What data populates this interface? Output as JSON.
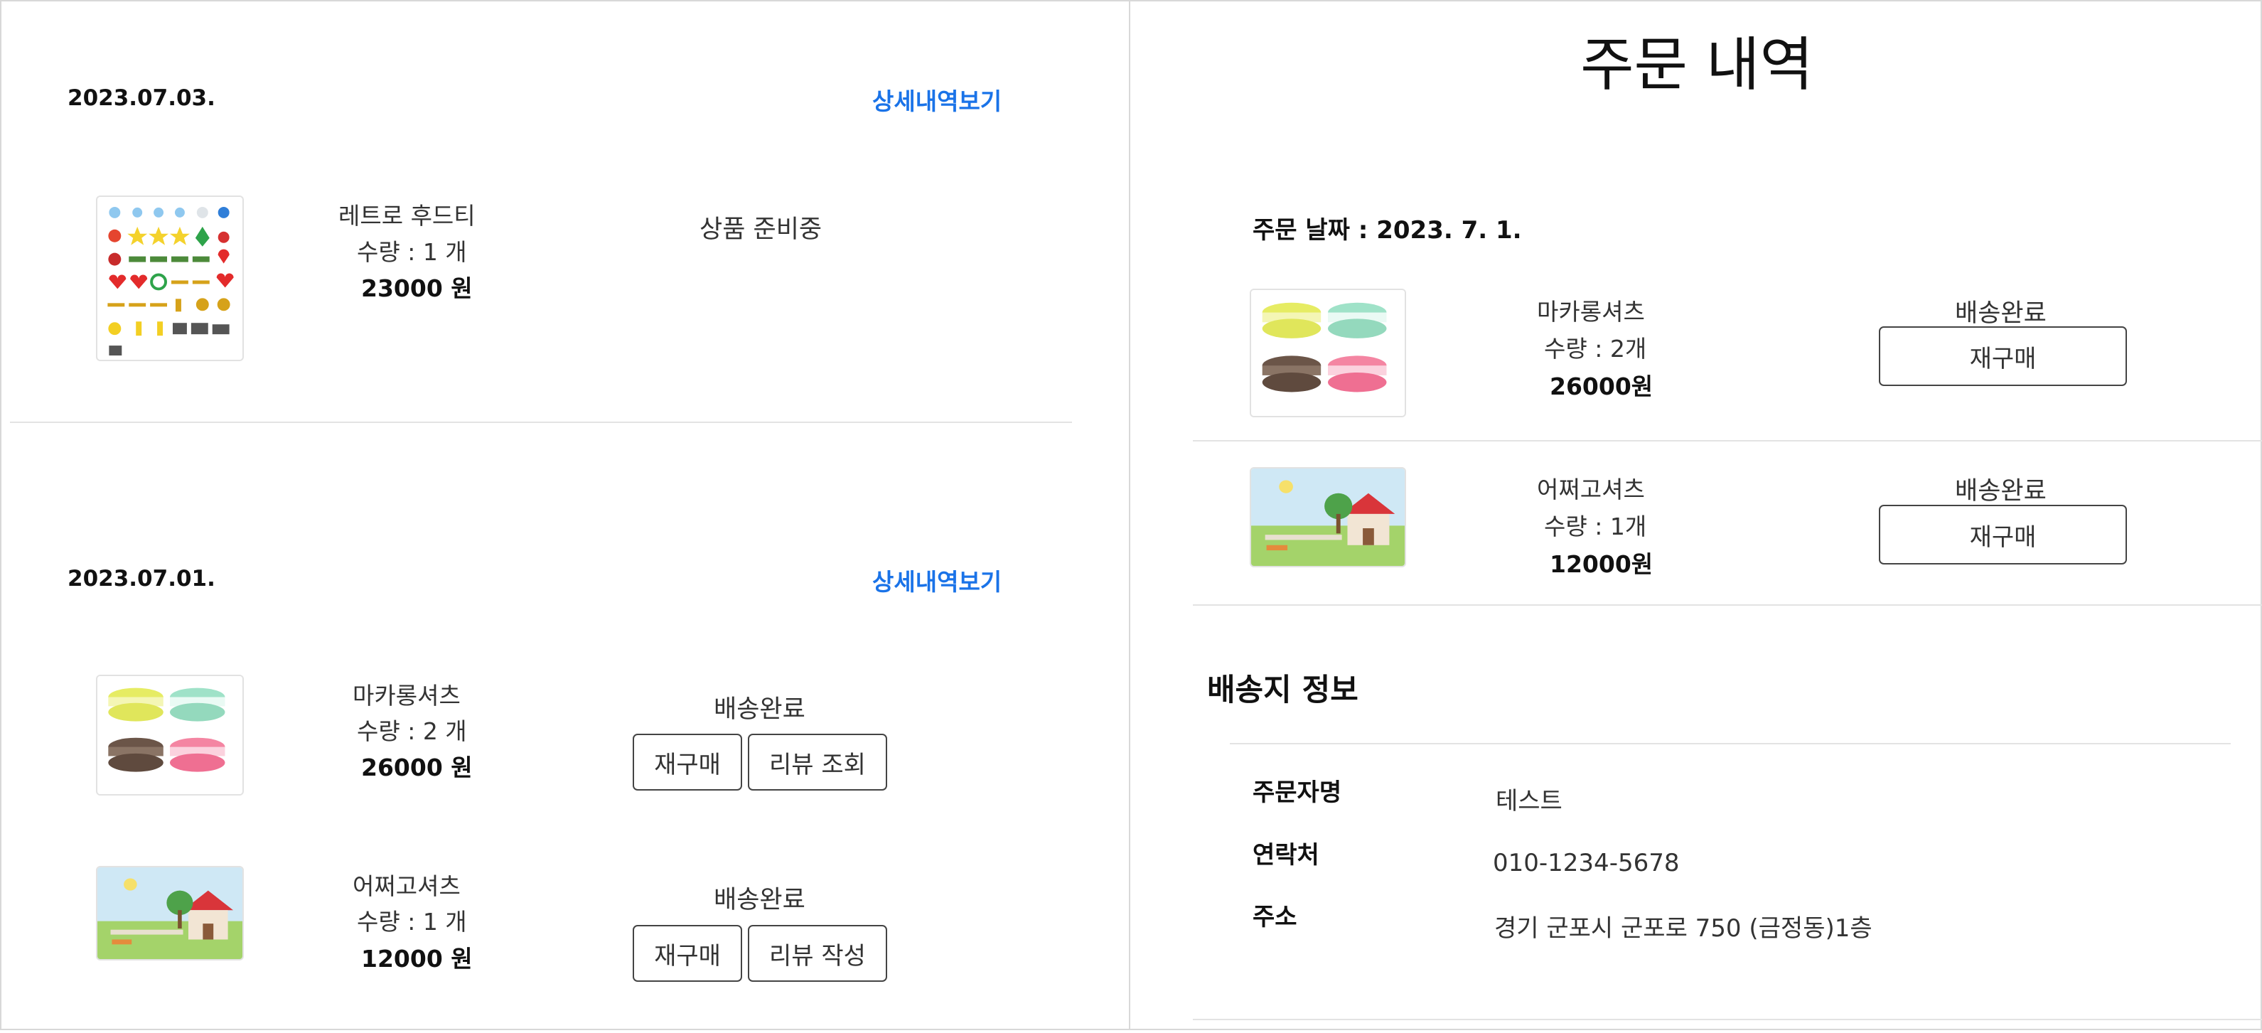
{
  "left": {
    "orders": [
      {
        "date": "2023.07.03.",
        "detail_link": "상세내역보기",
        "items": [
          {
            "name": "레트로 후드티",
            "qty": "수량 : 1 개",
            "price": "23000 원",
            "status": "상품 준비중",
            "buttons": []
          }
        ]
      },
      {
        "date": "2023.07.01.",
        "detail_link": "상세내역보기",
        "items": [
          {
            "name": "마카롱셔츠",
            "qty": "수량 : 2 개",
            "price": "26000 원",
            "status": "배송완료",
            "buttons": [
              "재구매",
              "리뷰 조회"
            ]
          },
          {
            "name": "어쩌고셔츠",
            "qty": "수량 : 1 개",
            "price": "12000 원",
            "status": "배송완료",
            "buttons": [
              "재구매",
              "리뷰 작성"
            ]
          }
        ]
      }
    ]
  },
  "right": {
    "title": "주문 내역",
    "order_date": "주문 날짜 : 2023. 7. 1.",
    "items": [
      {
        "name": "마카롱셔츠",
        "qty": "수량 : 2개",
        "price": "26000원",
        "status": "배송완료",
        "button": "재구매"
      },
      {
        "name": "어쩌고셔츠",
        "qty": "수량 : 1개",
        "price": "12000원",
        "status": "배송완료",
        "button": "재구매"
      }
    ],
    "shipping": {
      "heading": "배송지 정보",
      "orderer_label": "주문자명",
      "orderer_value": "테스트",
      "phone_label": "연락처",
      "phone_value": "010-1234-5678",
      "address_label": "주소",
      "address_value": "경기 군포시 군포로 750 (금정동)1층"
    }
  },
  "icons": {
    "retro_thumb": "pixel-icon-sheet",
    "macaron_thumb": "macaron-pixel-art",
    "scene_thumb": "pixel-landscape-house"
  }
}
